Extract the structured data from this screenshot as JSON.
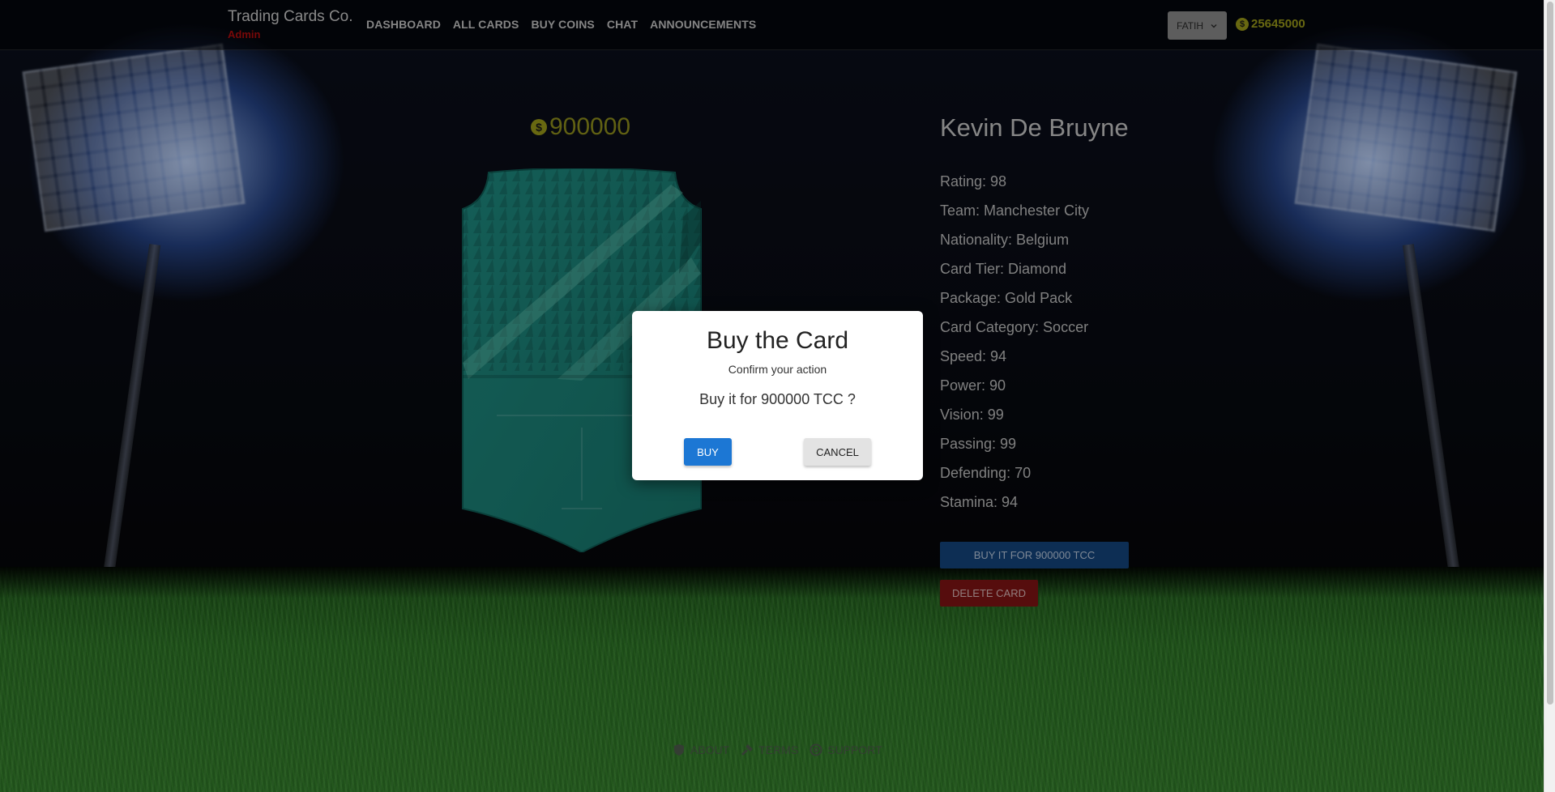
{
  "header": {
    "brand": "Trading Cards Co.",
    "brand_sub": "Admin",
    "nav": [
      "DASHBOARD",
      "ALL CARDS",
      "BUY COINS",
      "CHAT",
      "ANNOUNCEMENTS"
    ],
    "user": "FATIH",
    "coins": "25645000",
    "coin_symbol": "$"
  },
  "card": {
    "price": "900000",
    "coin_symbol": "$",
    "color": "#1f8a7c",
    "name": "Kevin De Bruyne",
    "stats": [
      "Rating: 98",
      "Team: Manchester City",
      "Nationality: Belgium",
      "Card Tier: Diamond",
      "Package: Gold Pack",
      "Card Category: Soccer",
      "Speed: 94",
      "Power: 90",
      "Vision: 99",
      "Passing: 99",
      "Defending: 70",
      "Stamina: 94"
    ],
    "buy_label": "BUY IT FOR 900000 TCC",
    "delete_label": "DELETE CARD"
  },
  "modal": {
    "title": "Buy the Card",
    "subtitle": "Confirm your action",
    "message": "Buy it for 900000 TCC ?",
    "buy_label": "BUY",
    "cancel_label": "CANCEL"
  },
  "footer": {
    "links": [
      {
        "label": "ABOUT",
        "icon": "shield-icon"
      },
      {
        "label": "TERMS",
        "icon": "gavel-icon"
      },
      {
        "label": "SUPPORT",
        "icon": "lifebuoy-icon"
      }
    ]
  }
}
